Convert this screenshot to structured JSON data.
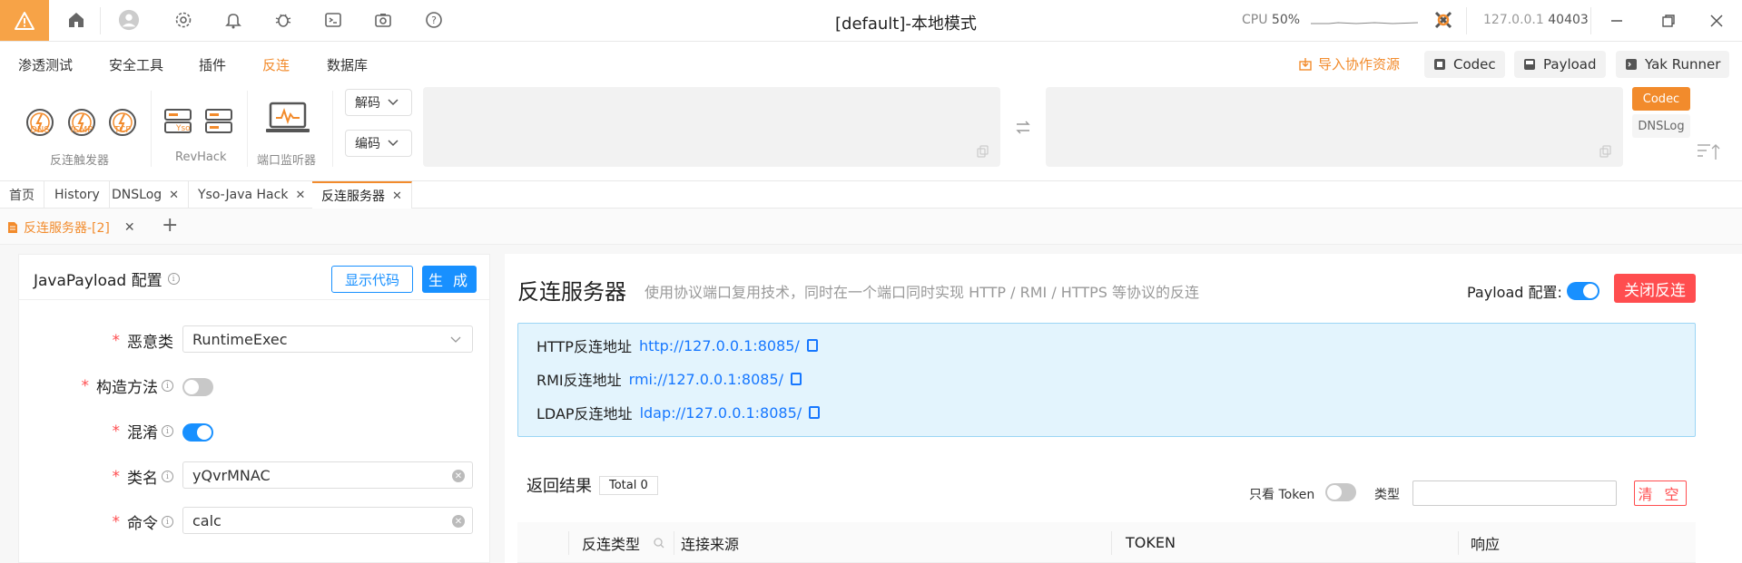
{
  "titlebar": {
    "title": "[default]-本地模式",
    "cpu_label": "CPU",
    "cpu_value": "50%",
    "ip": "127.0.0.1",
    "port": "40403"
  },
  "menu": {
    "items": [
      "渗透测试",
      "安全工具",
      "插件",
      "反连",
      "数据库"
    ],
    "active": "反连",
    "import_link": "导入协作资源",
    "buttons": [
      "Codec",
      "Payload",
      "Yak Runner"
    ]
  },
  "toolbar": {
    "gauges": [
      "DNS",
      "ICMP",
      "TCP"
    ],
    "group1_label": "反连触发器",
    "group2_label": "RevHack",
    "yso_label": "Yso",
    "group3_label": "端口监听器",
    "decode_label": "解码",
    "encode_label": "编码",
    "side_codec": "Codec",
    "side_dnslog": "DNSLog"
  },
  "tabs": [
    {
      "label": "首页",
      "closable": false
    },
    {
      "label": "History",
      "closable": false
    },
    {
      "label": "DNSLog",
      "closable": true
    },
    {
      "label": "Yso-Java Hack",
      "closable": true
    },
    {
      "label": "反连服务器",
      "closable": true,
      "active": true
    }
  ],
  "subtab": {
    "label": "反连服务器-[2]"
  },
  "left_panel": {
    "title": "JavaPayload 配置",
    "show_code_btn": "显示代码",
    "generate_btn": "生 成",
    "fields": {
      "malicious_class_label": "恶意类",
      "malicious_class_value": "RuntimeExec",
      "constructor_label": "构造方法",
      "constructor_on": false,
      "obfuscate_label": "混淆",
      "obfuscate_on": true,
      "classname_label": "类名",
      "classname_value": "yQvrMNAC",
      "command_label": "命令",
      "command_value": "calc"
    }
  },
  "right_panel": {
    "title": "反连服务器",
    "description": "使用协议端口复用技术，同时在一个端口同时实现 HTTP / RMI / HTTPS 等协议的反连",
    "payload_cfg_label": "Payload 配置:",
    "payload_cfg_on": true,
    "close_btn": "关闭反连",
    "addresses": [
      {
        "label": "HTTP反连地址",
        "url": "http://127.0.0.1:8085/"
      },
      {
        "label": "RMI反连地址",
        "url": "rmi://127.0.0.1:8085/"
      },
      {
        "label": "LDAP反连地址",
        "url": "ldap://127.0.0.1:8085/"
      }
    ],
    "results_label": "返回结果",
    "total": "Total 0",
    "only_token_label": "只看 Token",
    "only_token_on": false,
    "type_label": "类型",
    "clear_btn": "清 空",
    "columns": [
      "反连类型",
      "连接来源",
      "TOKEN",
      "响应"
    ]
  },
  "colors": {
    "accent": "#f28b2c",
    "primary": "#1890ff",
    "danger": "#ff4d4f"
  }
}
